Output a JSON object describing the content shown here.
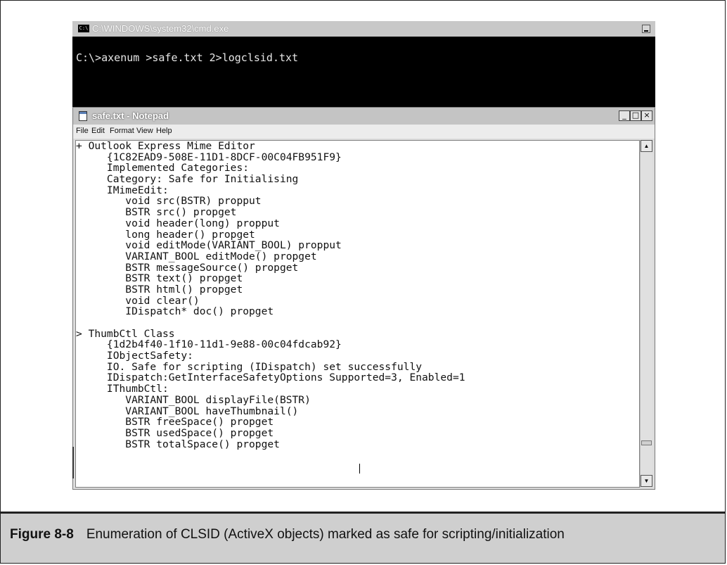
{
  "cmd_window": {
    "icon_text": "C:\\",
    "title": "C:\\WINDOWS\\system32\\cmd.exe",
    "command_line": "C:\\>axenum >safe.txt 2>logclsid.txt"
  },
  "notepad": {
    "title": "safe.txt - Notepad",
    "buttons": {
      "minimize": "_",
      "maximize": "□",
      "close": "×"
    },
    "menu": [
      "File",
      "Edit",
      "Format",
      "View",
      "Help"
    ],
    "lines": [
      "+ Outlook Express Mime Editor",
      "     {1C82EAD9-508E-11D1-8DCF-00C04FB951F9}",
      "     Implemented Categories:",
      "     Category: Safe for Initialising",
      "     IMimeEdit:",
      "        void src(BSTR) propput",
      "        BSTR src() propget",
      "        void header(long) propput",
      "        long header() propget",
      "        void editMode(VARIANT_BOOL) propput",
      "        VARIANT_BOOL editMode() propget",
      "        BSTR messageSource() propget",
      "        BSTR text() propget",
      "        BSTR html() propget",
      "        void clear()",
      "        IDispatch* doc() propget",
      "",
      "> ThumbCtl Class",
      "     {1d2b4f40-1f10-11d1-9e88-00c04fdcab92}",
      "     IObjectSafety:",
      "     IO. Safe for scripting (IDispatch) set successfully",
      "     IDispatch:GetInterfaceSafetyOptions Supported=3, Enabled=1",
      "     IThumbCtl:",
      "        VARIANT_BOOL displayFile(BSTR)",
      "        VARIANT_BOOL haveThumbnail()",
      "        BSTR freeSpace() propget",
      "        BSTR usedSpace() propget",
      "        BSTR totalSpace() propget"
    ],
    "scrollbar": {
      "up_arrow": "▲",
      "down_arrow": "▼"
    }
  },
  "caption": {
    "figure_number": "Figure 8-8",
    "text": "Enumeration of CLSID (ActiveX objects) marked as safe for scripting/initialization"
  }
}
